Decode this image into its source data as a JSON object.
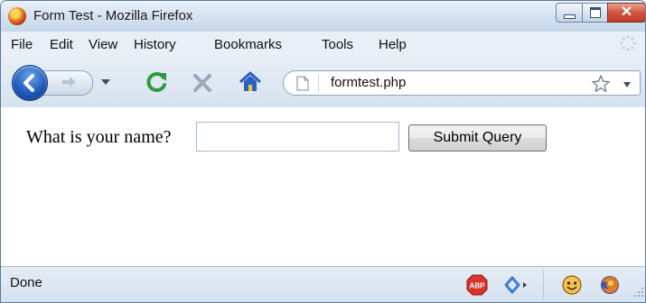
{
  "window": {
    "title": "Form Test - Mozilla Firefox"
  },
  "menu": {
    "items": [
      {
        "label": "File"
      },
      {
        "label": "Edit"
      },
      {
        "label": "View"
      },
      {
        "label": "History"
      },
      {
        "label": "Bookmarks"
      },
      {
        "label": "Tools"
      },
      {
        "label": "Help"
      }
    ]
  },
  "toolbar": {
    "url": "formtest.php"
  },
  "form": {
    "question": "What is your name?",
    "name_value": "",
    "submit_label": "Submit Query"
  },
  "status": {
    "text": "Done"
  },
  "colors": {
    "titlebar": "#d3e1ef",
    "close_button": "#d2553e",
    "back_button": "#1d57b8",
    "reload_green": "#2e9a3c",
    "stop_gray": "#9aa7b6",
    "home_blue": "#2b62c0"
  },
  "icons": [
    "firefox-logo-icon",
    "minimize-icon",
    "maximize-icon",
    "close-icon",
    "loading-spinner-icon",
    "back-arrow-icon",
    "forward-arrow-icon",
    "history-dropdown-icon",
    "reload-icon",
    "stop-icon",
    "home-icon",
    "page-icon",
    "bookmark-star-icon",
    "url-dropdown-icon",
    "adblock-icon",
    "mouse-gestures-icon",
    "smiley-icon",
    "firefox-icon",
    "resize-grip-icon"
  ]
}
